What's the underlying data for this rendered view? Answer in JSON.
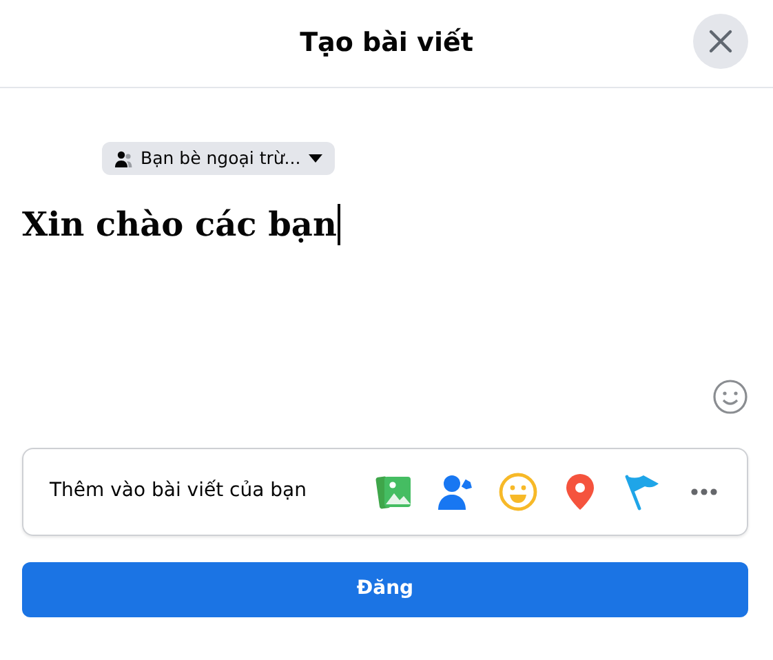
{
  "dialog": {
    "title": "Tạo bài viết"
  },
  "audience": {
    "label": "Bạn bè ngoại trừ..."
  },
  "post": {
    "text": "Xin chào các bạn"
  },
  "add_to_post": {
    "label": "Thêm vào bài viết của bạn"
  },
  "submit_button": {
    "label": "Đăng"
  }
}
